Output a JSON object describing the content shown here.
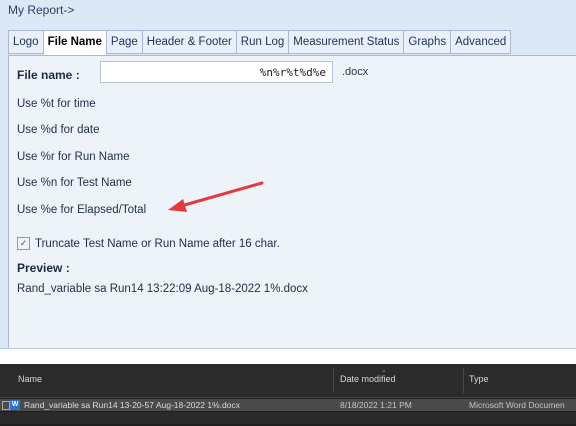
{
  "window": {
    "title": "My Report->"
  },
  "tabs": [
    "Logo",
    "File Name",
    "Page",
    "Header & Footer",
    "Run Log",
    "Measurement Status",
    "Graphs",
    "Advanced"
  ],
  "active_tab": "File Name",
  "file_name": {
    "label": "File name :",
    "value": "%n%r%t%d%e",
    "extension": ".docx"
  },
  "hints": [
    "Use %t for time",
    "Use %d for date",
    "Use %r for Run Name",
    "Use %n for Test Name",
    "Use %e for Elapsed/Total"
  ],
  "truncate": {
    "label": "Truncate Test Name or Run Name after 16 char.",
    "checked": true
  },
  "preview": {
    "label": "Preview :",
    "value": "Rand_variable sa Run14 13:22:09 Aug-18-2022 1%.docx"
  },
  "annotation": {
    "arrow_color": "#e33b3b"
  },
  "explorer": {
    "columns": {
      "name": "Name",
      "date_modified": "Date modified",
      "type": "Type"
    },
    "rows": [
      {
        "name": "Rand_variable sa Run14 13-20-57 Aug-18-2022 1%.docx",
        "date": "8/18/2022 1:21 PM",
        "type": "Microsoft Word Documen"
      }
    ]
  }
}
